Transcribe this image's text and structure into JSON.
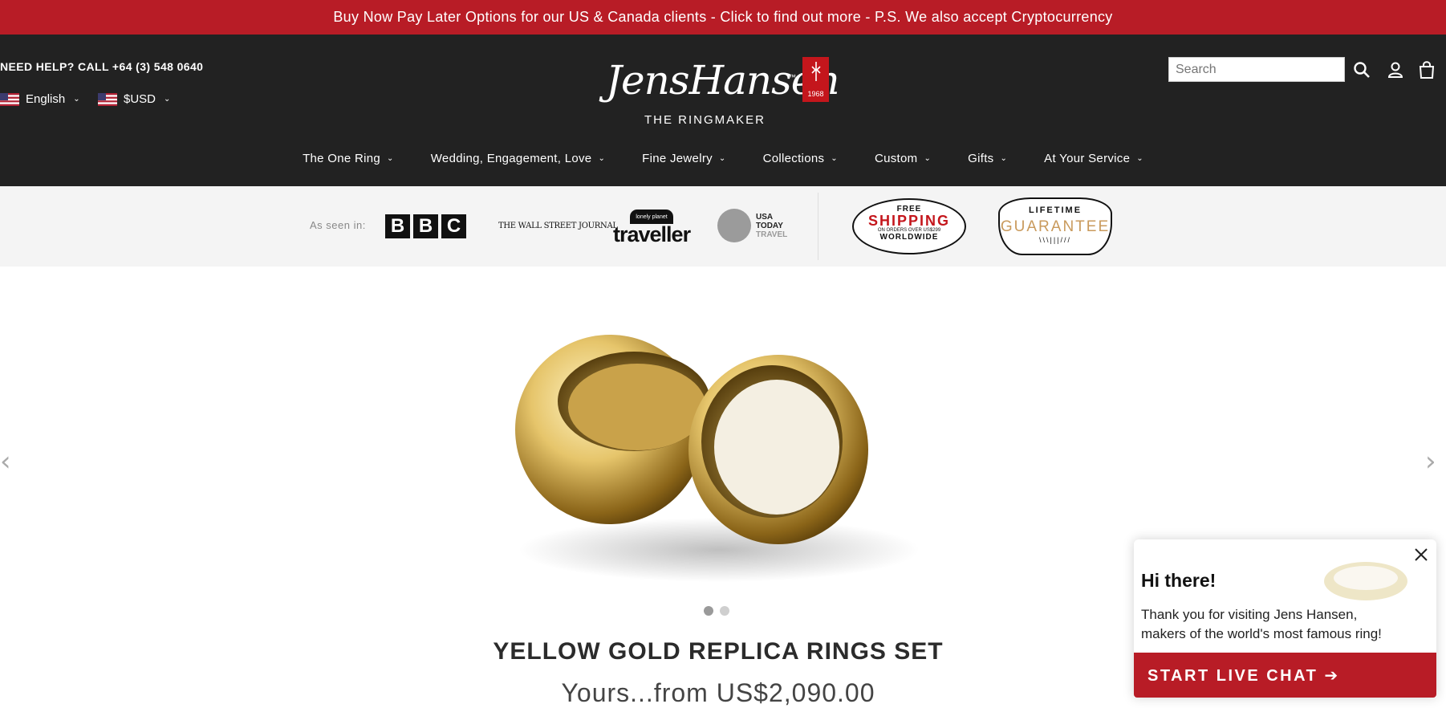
{
  "announcement": "Buy Now Pay Later Options for our US & Canada clients - Click to find out more - P.S. We also accept Cryptocurrency",
  "header": {
    "help": "NEED HELP? CALL +64 (3) 548 0640",
    "language": "English",
    "currency": "$USD",
    "logo": {
      "script": "JensHansen",
      "tagline": "THE RINGMAKER",
      "badge_year": "1968"
    },
    "search_placeholder": "Search",
    "icons": [
      "search-icon",
      "account-icon",
      "cart-icon"
    ]
  },
  "nav": [
    {
      "label": "The One Ring"
    },
    {
      "label": "Wedding, Engagement, Love"
    },
    {
      "label": "Fine Jewelry"
    },
    {
      "label": "Collections"
    },
    {
      "label": "Custom"
    },
    {
      "label": "Gifts"
    },
    {
      "label": "At Your Service"
    }
  ],
  "press": {
    "label": "As seen in:",
    "bbc": [
      "B",
      "B",
      "C"
    ],
    "wsj": "THE WALL STREET JOURNAL",
    "lonely_planet_top": "lonely planet",
    "lonely_planet": "traveller",
    "usa_today": [
      "USA",
      "TODAY",
      "TRAVEL"
    ],
    "shipping": {
      "top": "FREE",
      "main": "SHIPPING",
      "small": "ON ORDERS OVER US$299",
      "bottom": "WORLDWIDE"
    },
    "guarantee": {
      "top": "LIFETIME",
      "main": "GUARANTEE"
    }
  },
  "carousel": {
    "slides": 2,
    "active": 0
  },
  "product": {
    "title": "YELLOW GOLD REPLICA RINGS SET",
    "price": "Yours...from US$2,090.00"
  },
  "chat": {
    "heading": "Hi there!",
    "message": "Thank you for visiting Jens Hansen, makers of the world's most famous ring!",
    "button": "START LIVE CHAT ➔"
  },
  "colors": {
    "brand_red": "#b81c26",
    "header_bg": "#222222",
    "gold": "#c99a5c"
  }
}
